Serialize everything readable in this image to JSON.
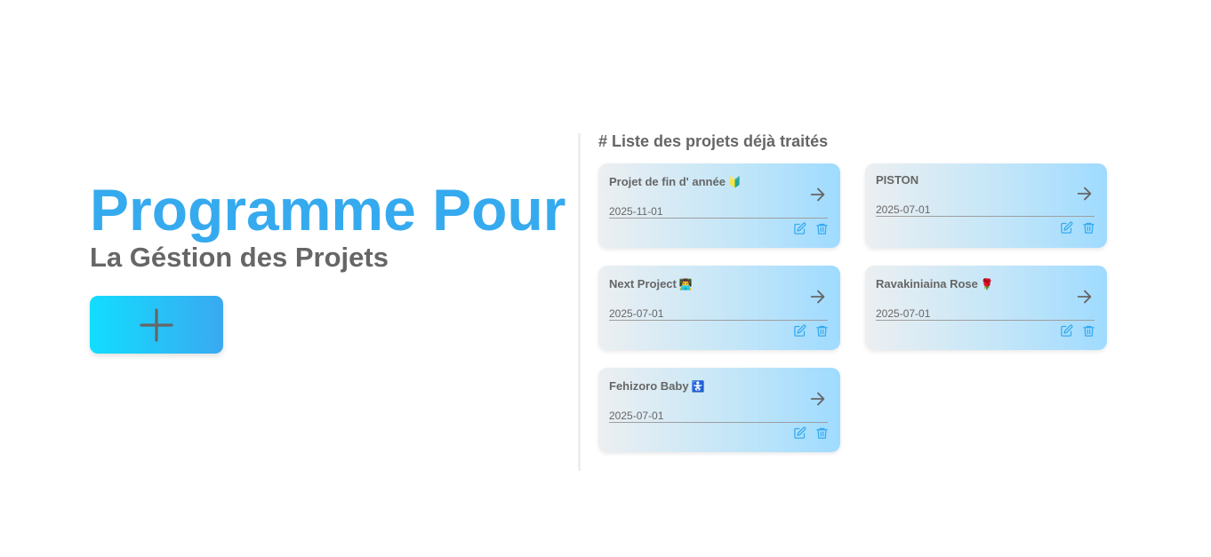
{
  "hero": {
    "title": "Programme Pour",
    "subtitle": "La Géstion des Projets",
    "add_button_icon": "plus-icon"
  },
  "list": {
    "heading": "# Liste des projets déjà traités",
    "projects": [
      {
        "title": "Projet de fin d' année",
        "emoji": "🔰",
        "date": "2025-11-01"
      },
      {
        "title": "PISTON",
        "emoji": "",
        "date": "2025-07-01"
      },
      {
        "title": "Next Project",
        "emoji": "👨‍💻",
        "date": "2025-07-01"
      },
      {
        "title": "Ravakiniaina Rose",
        "emoji": "🌹",
        "date": "2025-07-01"
      },
      {
        "title": "Fehizoro Baby",
        "emoji": "🚼",
        "date": "2025-07-01"
      }
    ]
  },
  "icons": {
    "open": "arrow-right-icon",
    "edit": "edit-icon",
    "delete": "trash-icon"
  },
  "colors": {
    "accent": "#36aaee",
    "text": "#666666",
    "button_gradient_start": "#12ddff",
    "button_gradient_end": "#3aa9f0"
  }
}
